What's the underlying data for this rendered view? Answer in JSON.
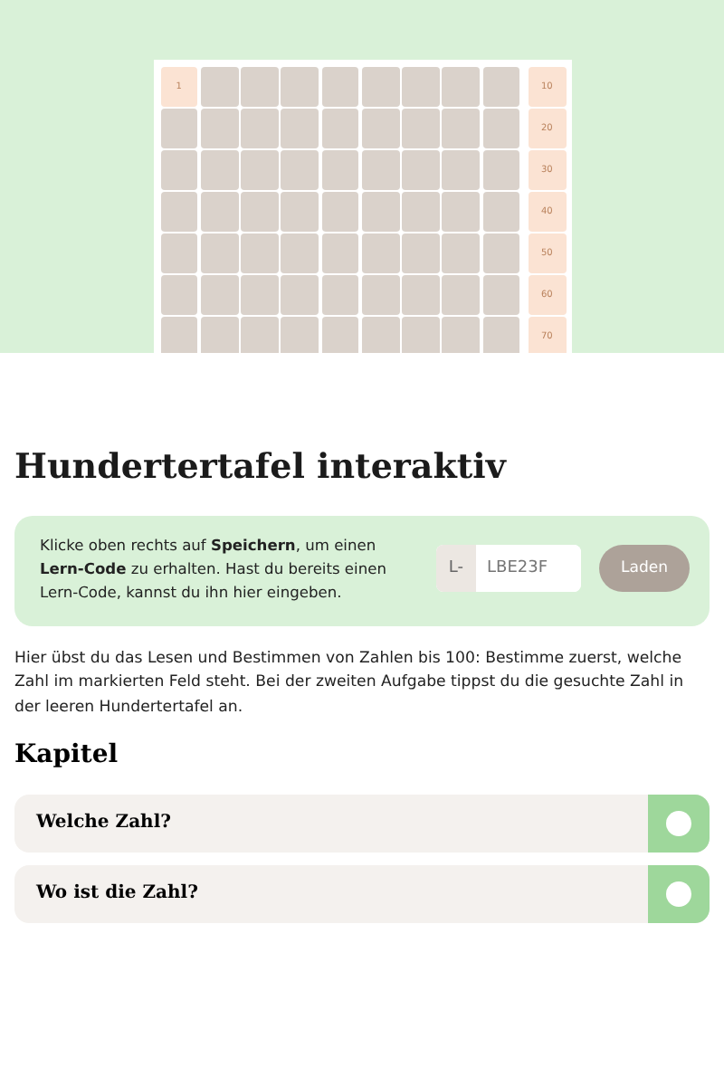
{
  "hundred_board": {
    "rows": [
      {
        "cells": [
          {
            "kind": "number",
            "text": "1"
          },
          {
            "kind": "blank"
          },
          {
            "kind": "blank"
          },
          {
            "kind": "blank"
          },
          {
            "kind": "blank"
          },
          {
            "kind": "blank"
          },
          {
            "kind": "blank"
          },
          {
            "kind": "blank"
          },
          {
            "kind": "blank"
          },
          {
            "kind": "number",
            "text": "10"
          }
        ]
      },
      {
        "cells": [
          {
            "kind": "blank"
          },
          {
            "kind": "blank"
          },
          {
            "kind": "blank"
          },
          {
            "kind": "blank"
          },
          {
            "kind": "blank"
          },
          {
            "kind": "blank"
          },
          {
            "kind": "blank"
          },
          {
            "kind": "blank"
          },
          {
            "kind": "blank"
          },
          {
            "kind": "number",
            "text": "20"
          }
        ]
      },
      {
        "cells": [
          {
            "kind": "blank"
          },
          {
            "kind": "blank"
          },
          {
            "kind": "blank"
          },
          {
            "kind": "blank"
          },
          {
            "kind": "blank"
          },
          {
            "kind": "blank"
          },
          {
            "kind": "blank"
          },
          {
            "kind": "blank"
          },
          {
            "kind": "blank"
          },
          {
            "kind": "number",
            "text": "30"
          }
        ]
      },
      {
        "cells": [
          {
            "kind": "blank"
          },
          {
            "kind": "blank"
          },
          {
            "kind": "blank"
          },
          {
            "kind": "blank"
          },
          {
            "kind": "blank"
          },
          {
            "kind": "blank"
          },
          {
            "kind": "blank"
          },
          {
            "kind": "blank"
          },
          {
            "kind": "blank"
          },
          {
            "kind": "number",
            "text": "40"
          }
        ]
      },
      {
        "cells": [
          {
            "kind": "blank"
          },
          {
            "kind": "blank"
          },
          {
            "kind": "blank"
          },
          {
            "kind": "blank"
          },
          {
            "kind": "blank"
          },
          {
            "kind": "blank"
          },
          {
            "kind": "blank"
          },
          {
            "kind": "blank"
          },
          {
            "kind": "blank"
          },
          {
            "kind": "number",
            "text": "50"
          }
        ]
      },
      {
        "cells": [
          {
            "kind": "blank"
          },
          {
            "kind": "blank"
          },
          {
            "kind": "blank"
          },
          {
            "kind": "blank"
          },
          {
            "kind": "blank"
          },
          {
            "kind": "blank"
          },
          {
            "kind": "blank"
          },
          {
            "kind": "blank"
          },
          {
            "kind": "blank"
          },
          {
            "kind": "number",
            "text": "60"
          }
        ]
      },
      {
        "cells": [
          {
            "kind": "blank"
          },
          {
            "kind": "blank"
          },
          {
            "kind": "blank"
          },
          {
            "kind": "blank"
          },
          {
            "kind": "blank"
          },
          {
            "kind": "blank"
          },
          {
            "kind": "blank"
          },
          {
            "kind": "blank"
          },
          {
            "kind": "blank"
          },
          {
            "kind": "number",
            "text": "70"
          }
        ]
      }
    ]
  },
  "title": "Hundertertafel interaktiv",
  "code_box": {
    "text": "Klicke oben rechts auf **Speichern**, um einen **Lern-Code** zu erhalten. Hast du bereits einen Lern-Code, kannst du ihn hier eingeben.",
    "prefix": "L-",
    "placeholder": "LBE23F",
    "button": "Laden"
  },
  "description": "Hier übst du das Lesen und Bestimmen von Zahlen bis 100: Bestimme zuerst, welche Zahl im markierten Feld steht. Bei der zweiten Aufgabe tippst du die gesuchte Zahl in der leeren Hundertertafel an.",
  "chapters_heading": "Kapitel",
  "chapters": [
    {
      "title": "Welche Zahl?"
    },
    {
      "title": "Wo ist die Zahl?"
    }
  ]
}
